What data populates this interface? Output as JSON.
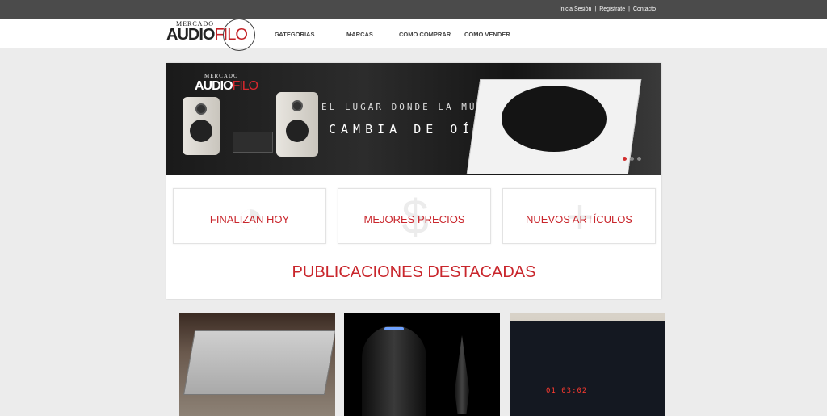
{
  "topbar": {
    "links": [
      "Inicia Sesión",
      "Registrate",
      "Contacto"
    ],
    "separator": "|"
  },
  "logo": {
    "line1": "MERCADO",
    "line2a": "AUDIO",
    "line2b": "FILO"
  },
  "nav": {
    "items": [
      {
        "label": "CATEGORIAS",
        "dropdown": true
      },
      {
        "label": "MARCAS",
        "dropdown": true
      },
      {
        "label": "COMO COMPRAR",
        "dropdown": false
      },
      {
        "label": "COMO VENDER",
        "dropdown": false
      }
    ]
  },
  "banner": {
    "logo_small": "MERCADO",
    "logo_a": "AUDIO",
    "logo_b": "FILO",
    "tagline1": "EL LUGAR DONDE LA MÚSICA",
    "tagline2": "CAMBIA DE OÍDOS"
  },
  "tiles": [
    {
      "label": "FINALIZAN HOY",
      "icon": "clock-icon"
    },
    {
      "label": "MEJORES PRECIOS",
      "icon": "dollar-icon"
    },
    {
      "label": "NUEVOS ARTÍCULOS",
      "icon": "plus-icon"
    }
  ],
  "featured_title": "PUBLICACIONES DESTACADAS",
  "product_3_display": "01 03:02",
  "colors": {
    "accent": "#c9262c",
    "topbar": "#4b4b4b",
    "background": "#ececec"
  }
}
